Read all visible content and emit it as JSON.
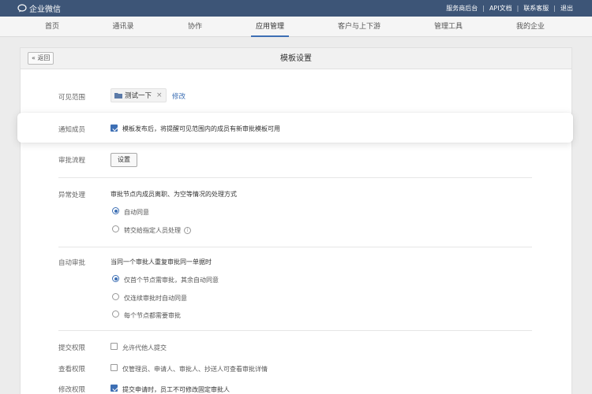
{
  "app": {
    "brand": "企业微信"
  },
  "toplinks": [
    "服务商后台",
    "API文档",
    "联系客服",
    "退出"
  ],
  "nav": {
    "tabs": [
      {
        "label": "首页"
      },
      {
        "label": "通讯录"
      },
      {
        "label": "协作"
      },
      {
        "label": "应用管理",
        "active": true
      },
      {
        "label": "客户与上下游"
      },
      {
        "label": "管理工具"
      },
      {
        "label": "我的企业"
      }
    ]
  },
  "panel": {
    "back_label": "« 返回",
    "title": "模板设置"
  },
  "visible_scope": {
    "label": "可见范围",
    "chip": "测试一下",
    "chip_remove": "×",
    "edit": "修改"
  },
  "notify": {
    "label": "通知成员",
    "checked": true,
    "text": "模板发布后，将提醒可见范围内的成员有新审批模板可用"
  },
  "flow": {
    "label": "审批流程",
    "button": "设置"
  },
  "exception": {
    "label": "异常处理",
    "desc": "审批节点内成员离职、为空等情况的处理方式",
    "options": [
      {
        "text": "自动同意",
        "selected": true
      },
      {
        "text": "转交给指定人员处理",
        "selected": false,
        "info": "i"
      }
    ]
  },
  "auto_approve": {
    "label": "自动审批",
    "desc": "当同一个审批人重复审批同一单据时",
    "options": [
      {
        "text": "仅首个节点需审批，其余自动同意",
        "selected": true
      },
      {
        "text": "仅连续审批时自动同意",
        "selected": false
      },
      {
        "text": "每个节点都需要审批",
        "selected": false
      }
    ]
  },
  "submit_perm": {
    "label": "提交权限",
    "text": "允许代他人提交",
    "checked": false
  },
  "view_perm": {
    "label": "查看权限",
    "text": "仅管理员、申请人、审批人、抄送人可查看审批详情",
    "checked": false
  },
  "edit_perm": {
    "label": "修改权限",
    "text": "提交申请时，员工不可修改固定审批人",
    "checked": true
  },
  "colors": {
    "topbar": "#3d5577",
    "accent": "#3d6fb4"
  }
}
